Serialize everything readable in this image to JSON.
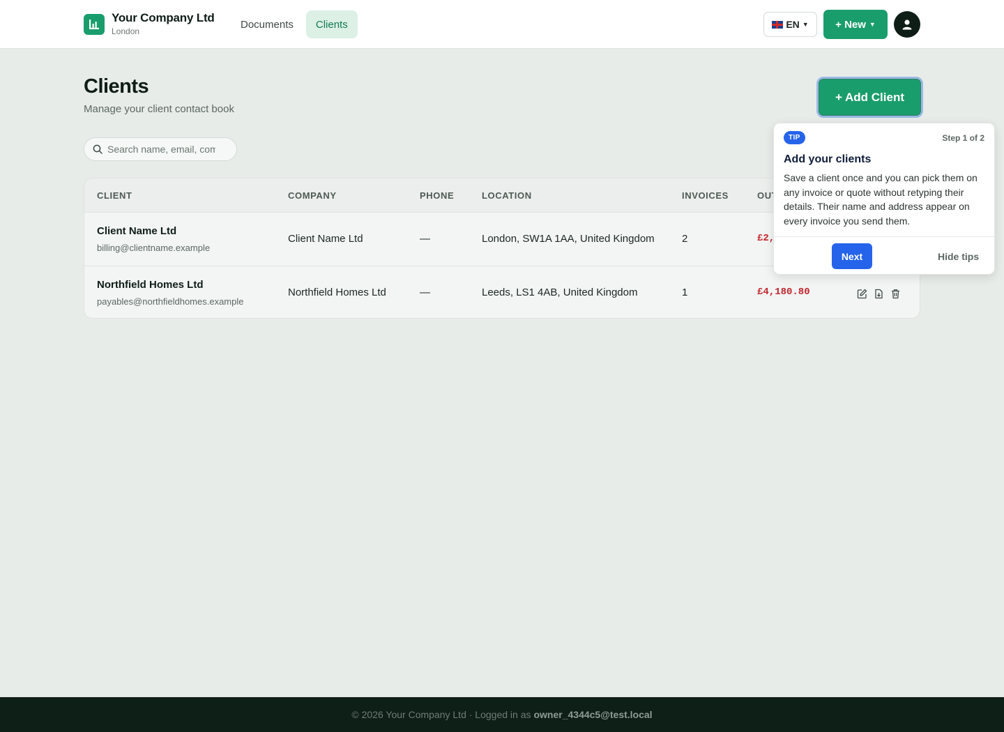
{
  "header": {
    "company_name": "Your Company Ltd",
    "company_location": "London",
    "nav": [
      {
        "label": "Documents",
        "active": false
      },
      {
        "label": "Clients",
        "active": true
      }
    ],
    "language": "EN",
    "new_button": "+ New",
    "accent_color": "#1a9d6c"
  },
  "page": {
    "title": "Clients",
    "subtitle": "Manage your client contact book",
    "add_button": "+ Add Client"
  },
  "search": {
    "placeholder": "Search name, email, company",
    "value": ""
  },
  "table": {
    "columns": [
      "CLIENT",
      "COMPANY",
      "PHONE",
      "LOCATION",
      "INVOICES",
      "OUT"
    ],
    "rows": [
      {
        "name": "Client Name Ltd",
        "email": "billing@clientname.example",
        "company": "Client Name Ltd",
        "phone": "—",
        "location": "London, SW1A 1AA, United Kingdom",
        "invoices": "2",
        "outstanding": "£2,"
      },
      {
        "name": "Northfield Homes Ltd",
        "email": "payables@northfieldhomes.example",
        "company": "Northfield Homes Ltd",
        "phone": "—",
        "location": "Leeds, LS1 4AB, United Kingdom",
        "invoices": "1",
        "outstanding": "£4,180.80"
      }
    ],
    "row_actions": [
      "edit-icon",
      "download-icon",
      "trash-icon"
    ]
  },
  "tip": {
    "badge": "TIP",
    "step": "Step 1 of 2",
    "title": "Add your clients",
    "body": "Save a client once and you can pick them on any invoice or quote without retyping their details. Their name and address appear on every invoice you send them.",
    "next_button": "Next",
    "hide_button": "Hide tips"
  },
  "footer": {
    "text": "© 2026 Your Company Ltd · Logged in as",
    "user": "owner_4344c5@test.local"
  }
}
